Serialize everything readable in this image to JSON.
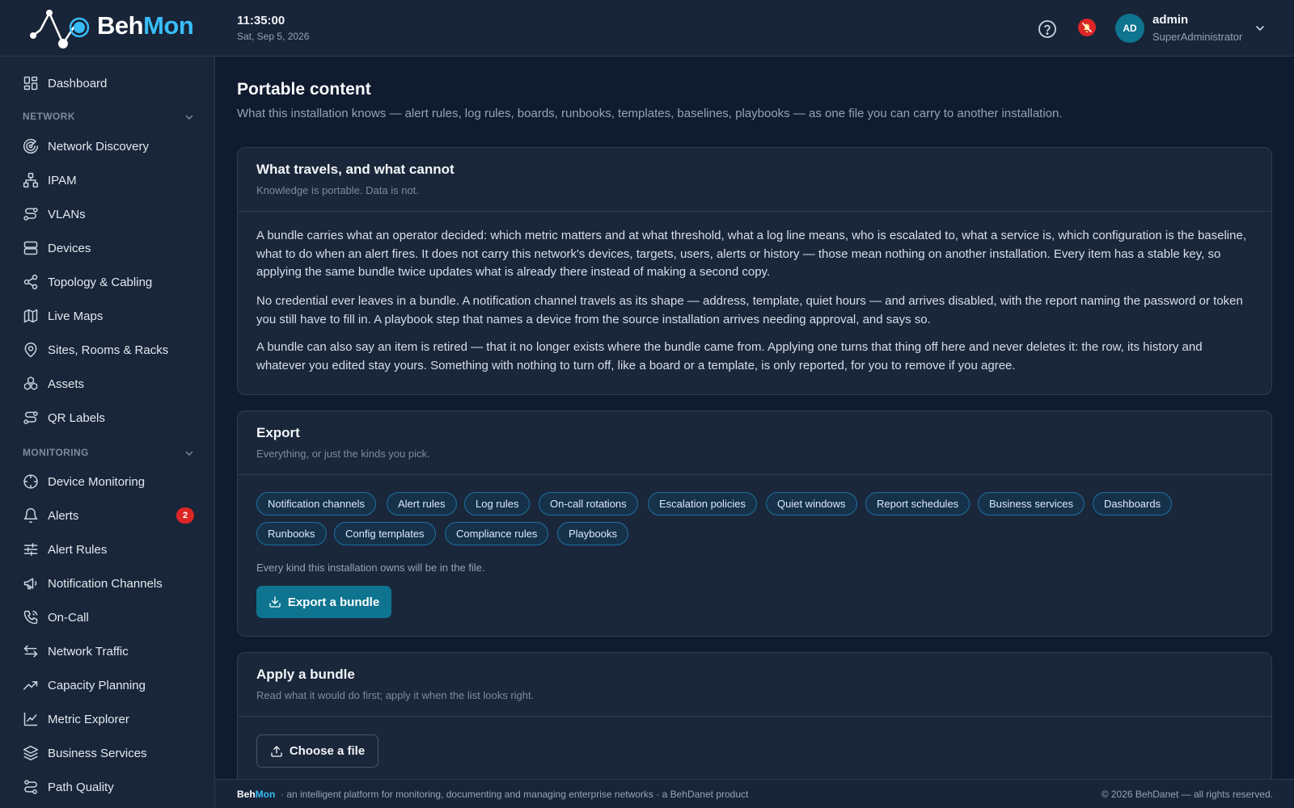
{
  "header": {
    "brand_part1": "Beh",
    "brand_part2": "Mon",
    "time": "11:35:00",
    "date": "Sat, Sep 5, 2026",
    "user": {
      "initials": "AD",
      "name": "admin",
      "role": "SuperAdministrator"
    }
  },
  "sidebar": {
    "top_item": {
      "label": "Dashboard",
      "icon": "dashboard-icon"
    },
    "network_section": "NETWORK",
    "network_items": [
      {
        "label": "Network Discovery",
        "icon": "radar-icon"
      },
      {
        "label": "IPAM",
        "icon": "sitemap-icon"
      },
      {
        "label": "VLANs",
        "icon": "route-icon"
      },
      {
        "label": "Devices",
        "icon": "server-icon"
      },
      {
        "label": "Topology & Cabling",
        "icon": "share-icon"
      },
      {
        "label": "Live Maps",
        "icon": "map-icon"
      },
      {
        "label": "Sites, Rooms & Racks",
        "icon": "map-pin-icon"
      },
      {
        "label": "Assets",
        "icon": "boxes-icon"
      },
      {
        "label": "QR Labels",
        "icon": "route-icon"
      }
    ],
    "monitoring_section": "MONITORING",
    "monitoring_items": [
      {
        "label": "Device Monitoring",
        "icon": "crosshair-icon"
      },
      {
        "label": "Alerts",
        "icon": "bell-icon",
        "badge": "2"
      },
      {
        "label": "Alert Rules",
        "icon": "sliders-icon"
      },
      {
        "label": "Notification Channels",
        "icon": "megaphone-icon"
      },
      {
        "label": "On-Call",
        "icon": "phone-icon"
      },
      {
        "label": "Network Traffic",
        "icon": "arrows-icon"
      },
      {
        "label": "Capacity Planning",
        "icon": "trending-up-icon"
      },
      {
        "label": "Metric Explorer",
        "icon": "line-chart-icon"
      },
      {
        "label": "Business Services",
        "icon": "layers-icon"
      },
      {
        "label": "Path Quality",
        "icon": "path-icon"
      }
    ]
  },
  "page": {
    "title": "Portable content",
    "subtitle": "What this installation knows — alert rules, log rules, boards, runbooks, templates, baselines, playbooks — as one file you can carry to another installation."
  },
  "travels_card": {
    "title": "What travels, and what cannot",
    "subtitle": "Knowledge is portable. Data is not.",
    "paragraphs": [
      "A bundle carries what an operator decided: which metric matters and at what threshold, what a log line means, who is escalated to, what a service is, which configuration is the baseline, what to do when an alert fires. It does not carry this network's devices, targets, users, alerts or history — those mean nothing on another installation. Every item has a stable key, so applying the same bundle twice updates what is already there instead of making a second copy.",
      "No credential ever leaves in a bundle. A notification channel travels as its shape — address, template, quiet hours — and arrives disabled, with the report naming the password or token you still have to fill in. A playbook step that names a device from the source installation arrives needing approval, and says so.",
      "A bundle can also say an item is retired — that it no longer exists where the bundle came from. Applying one turns that thing off here and never deletes it: the row, its history and whatever you edited stay yours. Something with nothing to turn off, like a board or a template, is only reported, for you to remove if you agree."
    ]
  },
  "export_card": {
    "title": "Export",
    "subtitle": "Everything, or just the kinds you pick.",
    "kinds": [
      "Notification channels",
      "Alert rules",
      "Log rules",
      "On-call rotations",
      "Escalation policies",
      "Quiet windows",
      "Report schedules",
      "Business services",
      "Dashboards",
      "Runbooks",
      "Config templates",
      "Compliance rules",
      "Playbooks"
    ],
    "hint": "Every kind this installation owns will be in the file.",
    "button": "Export a bundle"
  },
  "apply_card": {
    "title": "Apply a bundle",
    "subtitle": "Read what it would do first; apply it when the list looks right.",
    "button": "Choose a file"
  },
  "footer": {
    "brand_part1": "Beh",
    "brand_part2": "Mon",
    "tagline": "· an intelligent platform for monitoring, documenting and managing enterprise networks · a BehDanet product",
    "copyright": "© 2026 BehDanet — all rights reserved."
  },
  "colors": {
    "accent": "#0e7490",
    "brand_highlight": "#38bdf8",
    "badge": "#dc2626",
    "background": "#101b2f",
    "card": "#1a2639"
  }
}
